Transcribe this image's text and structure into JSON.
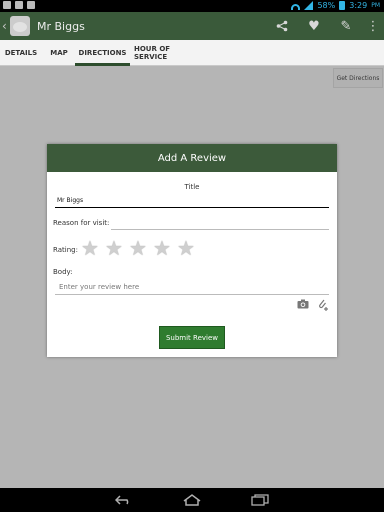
{
  "status_bar": {
    "battery": "58%",
    "time": "3:29",
    "time_suffix": "PM"
  },
  "action_bar": {
    "title": "Mr Biggs"
  },
  "tabs": [
    {
      "label": "DETAILS"
    },
    {
      "label": "MAP"
    },
    {
      "label": "DIRECTIONS"
    },
    {
      "label": "HOUR OF SERVICE"
    }
  ],
  "content": {
    "get_directions_label": "Get Directions"
  },
  "dialog": {
    "title": "Add A Review",
    "title_field_label": "Title",
    "title_value": "Mr Biggs",
    "reason_label": "Reason for visit:",
    "reason_value": "",
    "rating_label": "Rating:",
    "rating": 0,
    "rating_max": 5,
    "body_label": "Body:",
    "body_placeholder": "Enter your review here",
    "submit_label": "Submit Review"
  },
  "accent_colors": {
    "action_bar": "#3a5a3a",
    "submit": "#2f7c2f",
    "status_icons": "#33b5e5"
  }
}
